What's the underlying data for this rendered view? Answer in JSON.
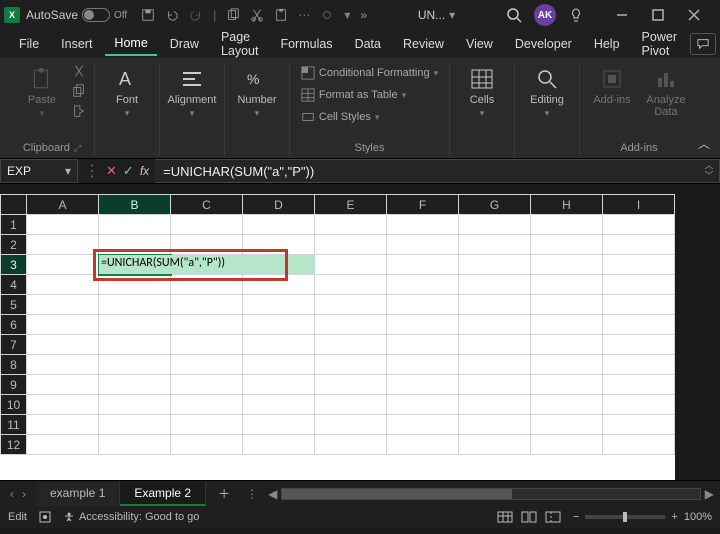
{
  "titlebar": {
    "autosave_label": "AutoSave",
    "autosave_state": "Off",
    "doc_title": "UN...",
    "avatar_initials": "AK"
  },
  "menu": {
    "items": [
      "File",
      "Insert",
      "Home",
      "Draw",
      "Page Layout",
      "Formulas",
      "Data",
      "Review",
      "View",
      "Developer",
      "Help",
      "Power Pivot"
    ],
    "active": "Home"
  },
  "ribbon": {
    "clipboard": {
      "paste": "Paste",
      "label": "Clipboard"
    },
    "font": {
      "btn": "Font"
    },
    "alignment": {
      "btn": "Alignment"
    },
    "number": {
      "btn": "Number"
    },
    "styles": {
      "cond": "Conditional Formatting",
      "table": "Format as Table",
      "cell": "Cell Styles",
      "label": "Styles"
    },
    "cells": {
      "btn": "Cells"
    },
    "editing": {
      "btn": "Editing"
    },
    "addins": {
      "btn": "Add-ins",
      "analyze": "Analyze Data",
      "label": "Add-ins"
    }
  },
  "namebox": {
    "value": "EXP"
  },
  "formula_bar": {
    "value": "=UNICHAR(SUM(\"a\",\"P\"))"
  },
  "grid": {
    "columns": [
      "A",
      "B",
      "C",
      "D",
      "E",
      "F",
      "G",
      "H",
      "I"
    ],
    "rows": [
      1,
      2,
      3,
      4,
      5,
      6,
      7,
      8,
      9,
      10,
      11,
      12
    ],
    "active_col": "B",
    "active_row": 3,
    "cell_display": "=UNICHAR(SUM(\"a\",\"P\"))"
  },
  "sheets": {
    "tabs": [
      "example 1",
      "Example 2"
    ],
    "active": "Example 2"
  },
  "status": {
    "mode": "Edit",
    "accessibility": "Accessibility: Good to go",
    "zoom": "100%"
  }
}
